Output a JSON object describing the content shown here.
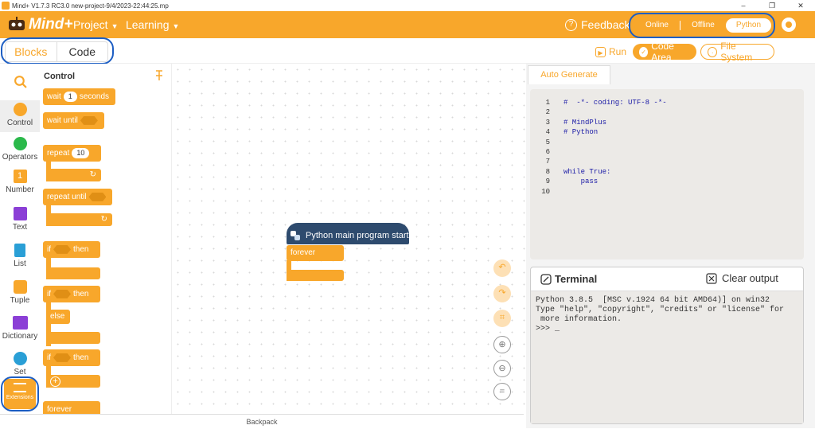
{
  "titlebar": {
    "title": "Mind+ V1.7.3 RC3.0   new-project-9/4/2023-22:44:25.mp",
    "minimize": "–",
    "restore": "❐",
    "close": "✕"
  },
  "menubar": {
    "logo_text": "Mind+",
    "project_label": "Project",
    "learning_label": "Learning",
    "feedback_label": "Feedback",
    "modes": [
      "Online",
      "Offline",
      "Python"
    ],
    "active_mode": "Python",
    "accent": "#f8a72b",
    "annotation_ring_color": "#1d5ec3"
  },
  "toolbar": {
    "tab_blocks": "Blocks",
    "tab_code": "Code",
    "run_label": "Run",
    "code_area_label": "Code Area",
    "file_system_label": "File System"
  },
  "categories": [
    {
      "label": "Control",
      "color": "#f8a72b"
    },
    {
      "label": "Operators",
      "color": "#2bb94b"
    },
    {
      "label": "Number",
      "color": "#f8a72b",
      "glyph": "1"
    },
    {
      "label": "Text",
      "color": "#8b3fd6"
    },
    {
      "label": "List",
      "color": "#2a9fd6"
    },
    {
      "label": "Tuple",
      "color": "#f8a72b"
    },
    {
      "label": "Dictionary",
      "color": "#8b3fd6"
    },
    {
      "label": "Set",
      "color": "#2a9fd6"
    },
    {
      "label": "Extensions",
      "color": "#f8a72b"
    }
  ],
  "palette": {
    "heading": "Control",
    "wait_pre": "wait",
    "wait_value": "1",
    "wait_post": "seconds",
    "wait_until": "wait until",
    "repeat": "repeat",
    "repeat_value": "10",
    "repeat_until": "repeat until",
    "if": "if",
    "then": "then",
    "else": "else",
    "forever": "forever",
    "loop_arrow": "↻",
    "plus": "+"
  },
  "workspace": {
    "hat_label": "Python main program start",
    "forever_label": "forever",
    "hat_color": "#2e4b6e",
    "backpack_label": "Backpack"
  },
  "code_panel": {
    "tab_label": "Auto Generate",
    "lines": [
      {
        "n": "1",
        "text": "#  -*- coding: UTF-8 -*-"
      },
      {
        "n": "2",
        "text": ""
      },
      {
        "n": "3",
        "text": "# MindPlus"
      },
      {
        "n": "4",
        "text": "# Python"
      },
      {
        "n": "5",
        "text": ""
      },
      {
        "n": "6",
        "text": ""
      },
      {
        "n": "7",
        "text": ""
      },
      {
        "n": "8",
        "text": "while True:"
      },
      {
        "n": "9",
        "text": "    pass"
      },
      {
        "n": "10",
        "text": ""
      }
    ]
  },
  "terminal": {
    "title": "Terminal",
    "clear_label": "Clear output",
    "output": "Python 3.8.5  [MSC v.1924 64 bit AMD64)] on win32\nType \"help\", \"copyright\", \"credits\" or \"license\" for\n more information.\n>>> _"
  }
}
